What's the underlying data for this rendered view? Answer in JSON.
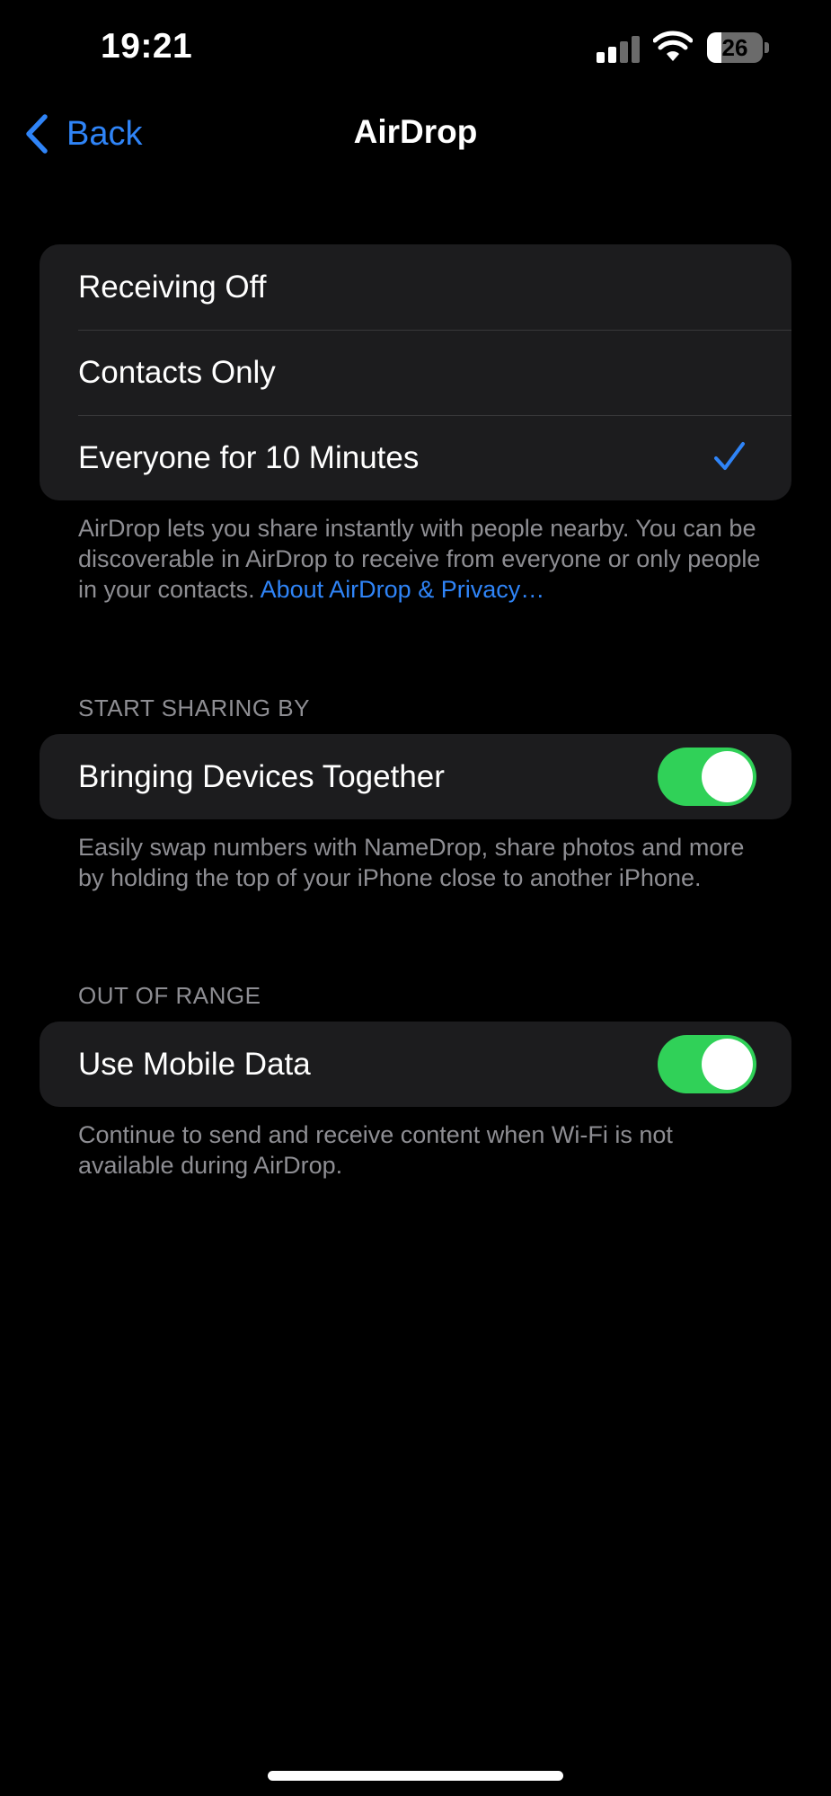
{
  "status_bar": {
    "time": "19:21",
    "battery_level": "26",
    "battery_fraction": 0.26,
    "icons": [
      "cellular-signal-icon",
      "wifi-icon",
      "battery-icon"
    ]
  },
  "nav": {
    "back_label": "Back",
    "title": "AirDrop"
  },
  "receiving": {
    "options": [
      {
        "label": "Receiving Off",
        "selected": false
      },
      {
        "label": "Contacts Only",
        "selected": false
      },
      {
        "label": "Everyone for 10 Minutes",
        "selected": true
      }
    ],
    "footer_text": "AirDrop lets you share instantly with people nearby. You can be discoverable in AirDrop to receive from everyone or only people in your contacts. ",
    "footer_link": "About AirDrop & Privacy…"
  },
  "start_sharing": {
    "header": "START SHARING BY",
    "row_label": "Bringing Devices Together",
    "toggle_on": true,
    "footer_text": "Easily swap numbers with NameDrop, share photos and more by holding the top of your iPhone close to another iPhone."
  },
  "out_of_range": {
    "header": "OUT OF RANGE",
    "row_label": "Use Mobile Data",
    "toggle_on": true,
    "footer_text": "Continue to send and receive content when Wi-Fi is not available during AirDrop."
  },
  "colors": {
    "accent": "#2f84f7",
    "toggle_on": "#30d158",
    "group_bg": "#1c1c1e",
    "secondary_text": "#8e8e93"
  }
}
